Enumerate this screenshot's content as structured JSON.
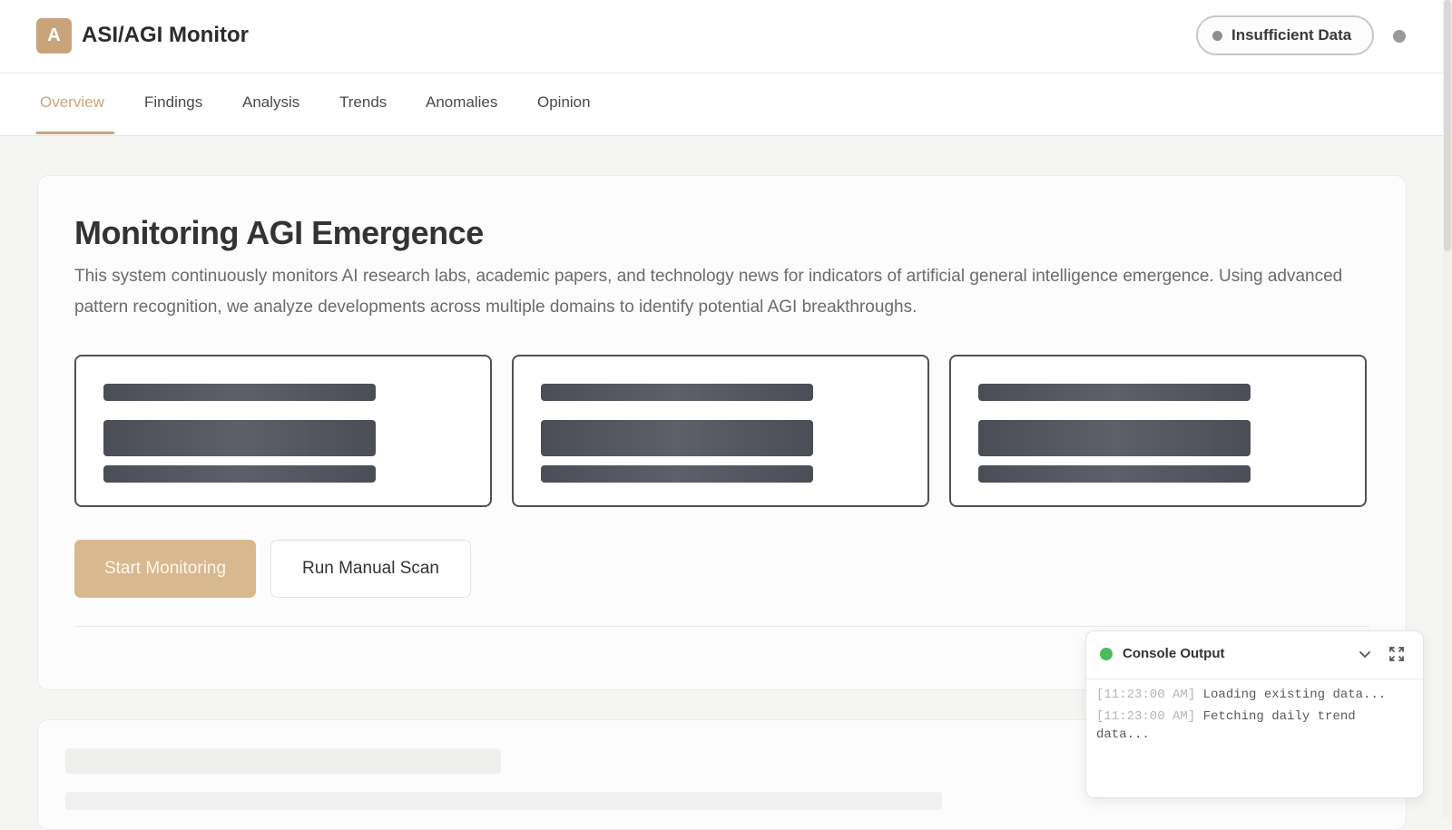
{
  "app": {
    "logo_letter": "A",
    "title": "ASI/AGI Monitor",
    "status_label": "Insufficient Data",
    "accent_color": "#c9a47a"
  },
  "tabs": [
    {
      "label": "Overview",
      "active": true
    },
    {
      "label": "Findings",
      "active": false
    },
    {
      "label": "Analysis",
      "active": false
    },
    {
      "label": "Trends",
      "active": false
    },
    {
      "label": "Anomalies",
      "active": false
    },
    {
      "label": "Opinion",
      "active": false
    }
  ],
  "main": {
    "title": "Monitoring AGI Emergence",
    "description": "This system continuously monitors AI research labs, academic papers, and technology news for indicators of artificial general intelligence emergence. Using advanced pattern recognition, we analyze developments across multiple domains to identify potential AGI breakthroughs.",
    "primary_button": "Start Monitoring",
    "secondary_button": "Run Manual Scan"
  },
  "console": {
    "title": "Console Output",
    "status_color": "#4cbb5c",
    "icons": [
      "chevron-down-icon",
      "expand-icon"
    ],
    "logs": [
      {
        "time": "[11:23:00 AM]",
        "message": "Loading existing data..."
      },
      {
        "time": "[11:23:00 AM]",
        "message": "Fetching daily trend data..."
      }
    ]
  }
}
